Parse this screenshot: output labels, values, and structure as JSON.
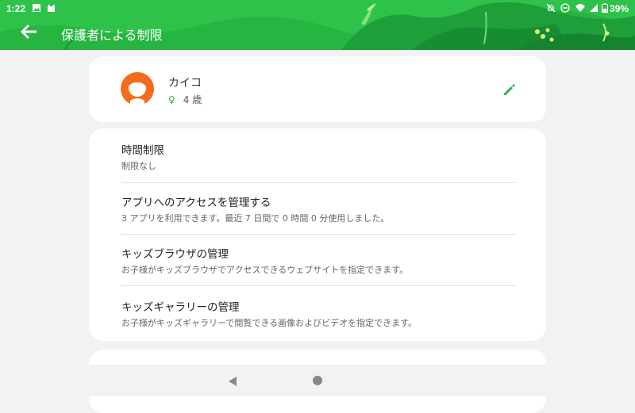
{
  "status_bar": {
    "time": "1:22",
    "battery": "39%",
    "icons": [
      "image-icon",
      "cat-icon",
      "mute-icon",
      "dnd-icon",
      "wifi-icon",
      "signal-icon",
      "battery-icon"
    ]
  },
  "header": {
    "title": "保護者による制限",
    "back_icon": "arrow-back-icon",
    "background_color": "#2ec24a"
  },
  "profile": {
    "name": "カイコ",
    "gender_symbol": "♀",
    "age": "4 歳",
    "avatar_color": "#f36c1a",
    "edit_icon": "pencil-icon"
  },
  "settings": {
    "items": [
      {
        "title": "時間制限",
        "subtitle": "制限なし"
      },
      {
        "title": "アプリへのアクセスを管理する",
        "subtitle": "3 アプリを利用できます。最近 7 日間で 0 時間 0 分使用しました。"
      },
      {
        "title": "キッズブラウザの管理",
        "subtitle": "お子様がキッズブラウザでアクセスできるウェブサイトを指定できます。"
      },
      {
        "title": "キッズギャラリーの管理",
        "subtitle": "お子様がキッズギャラリーで閲覧できる画像およびビデオを指定できます。"
      }
    ]
  },
  "partial_card": {
    "title": ""
  },
  "navbar": {
    "icons": [
      "nav-back-icon",
      "nav-home-icon"
    ]
  },
  "colors": {
    "accent": "#21b046",
    "header": "#2ec24a",
    "background": "#f2f2f2"
  }
}
